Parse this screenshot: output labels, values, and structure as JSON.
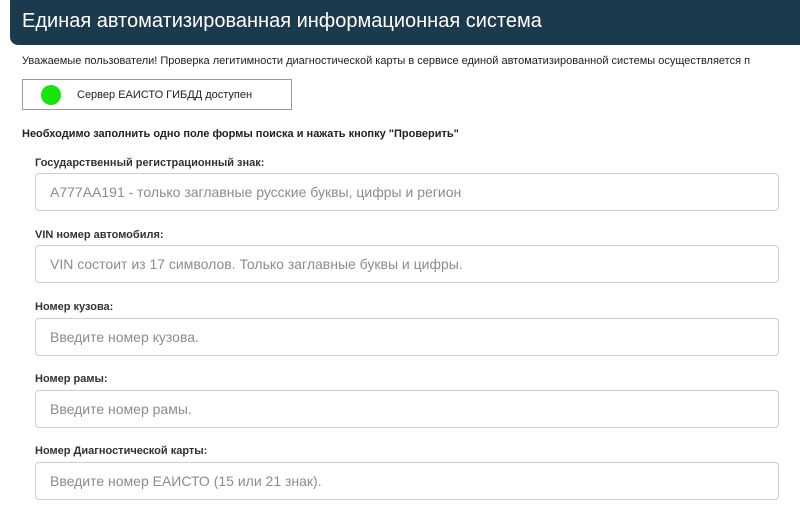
{
  "header": {
    "title": "Единая автоматизированная информационная система"
  },
  "notice": {
    "text": "Уважаемые пользователи! Проверка легитимности диагностической карты в сервисе единой автоматизированной системы осуществляется п"
  },
  "server_status": {
    "text": "Сервер ЕАИСТО ГИБДД доступен",
    "indicator_color": "#19e30c"
  },
  "form": {
    "instruction": "Необходимо заполнить одно поле формы поиска и нажать кнопку \"Проверить\"",
    "fields": [
      {
        "label": "Государственный регистрационный знак:",
        "value": "",
        "placeholder": "А777АА191 - только заглавные русские буквы, цифры и регион"
      },
      {
        "label": "VIN номер автомобиля:",
        "value": "",
        "placeholder": "VIN состоит из 17 символов. Только заглавные буквы и цифры."
      },
      {
        "label": "Номер кузова:",
        "value": "",
        "placeholder": "Введите номер кузова."
      },
      {
        "label": "Номер рамы:",
        "value": "",
        "placeholder": "Введите номер рамы."
      },
      {
        "label": "Номер Диагностической карты:",
        "value": "",
        "placeholder": "Введите номер ЕАИСТО (15 или 21 знак)."
      }
    ]
  },
  "colors": {
    "header_bg": "#1c3a4e",
    "input_border": "#cfcfcf"
  }
}
